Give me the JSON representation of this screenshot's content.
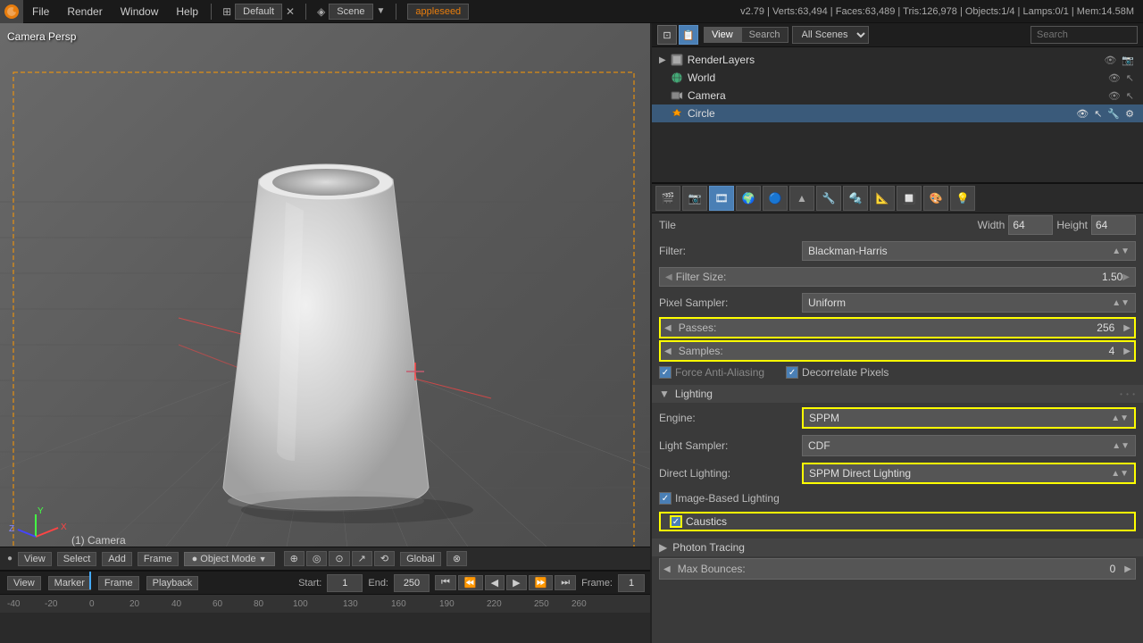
{
  "topbar": {
    "logo": "B",
    "menus": [
      "File",
      "Render",
      "Window",
      "Help"
    ],
    "workspace_icon": "⊞",
    "layout": "Default",
    "scene_icon": "◈",
    "scene": "Scene",
    "app_name": "appleseed",
    "version_info": "v2.79 | Verts:63,494 | Faces:63,489 | Tris:126,978 | Objects:1/4 | Lamps:0/1 | Mem:14.58M"
  },
  "viewport": {
    "label": "Camera Persp",
    "camera_label": "(1) Camera"
  },
  "timeline": {
    "marker_label": "Marker",
    "frame_label": "Frame",
    "playback_label": "Playback",
    "start_label": "Start:",
    "start_value": "1",
    "end_label": "End:",
    "end_value": "250",
    "current_frame": "1",
    "ruler_marks": [
      "-40",
      "-20",
      "0",
      "20",
      "40",
      "60",
      "80",
      "100",
      "130",
      "160",
      "190",
      "220",
      "250",
      "260"
    ],
    "buttons": {
      "view": "View",
      "select": "Select",
      "add": "Add",
      "frame": "Frame",
      "object_mode": "Object Mode",
      "global": "Global"
    }
  },
  "outliner": {
    "header_tabs": [
      "View",
      "Search"
    ],
    "scenes_label": "All Scenes",
    "items": [
      {
        "name": "RenderLayers",
        "icon": "📷",
        "indent": 0
      },
      {
        "name": "World",
        "icon": "🌍",
        "indent": 1
      },
      {
        "name": "Camera",
        "icon": "🎥",
        "indent": 1
      },
      {
        "name": "Circle",
        "icon": "▽",
        "indent": 1,
        "selected": true
      }
    ]
  },
  "properties": {
    "tabs": [
      "🎬",
      "📷",
      "🎞",
      "🌍",
      "🔵",
      "▲",
      "🔧",
      "🔩",
      "📐",
      "🔲",
      "🎨",
      "💡"
    ],
    "active_tab": 2,
    "tile": {
      "label": "Tile",
      "width_label": "Width",
      "width_value": "64",
      "height_label": "Height",
      "height_value": "64"
    },
    "filter": {
      "label": "Filter:",
      "value": "Blackman-Harris"
    },
    "filter_size": {
      "label": "Filter Size:",
      "value": "1.50"
    },
    "pixel_sampler": {
      "label": "Pixel Sampler:",
      "value": "Uniform"
    },
    "passes": {
      "label": "Passes:",
      "value": "256"
    },
    "samples": {
      "label": "Samples:",
      "value": "4"
    },
    "force_anti_aliasing": {
      "label": "Force Anti-Aliasing",
      "checked": true
    },
    "decorrelate_pixels": {
      "label": "Decorrelate Pixels",
      "checked": true
    },
    "lighting": {
      "section_label": "Lighting",
      "engine": {
        "label": "Engine:",
        "value": "SPPM"
      },
      "light_sampler": {
        "label": "Light Sampler:",
        "value": "CDF"
      },
      "direct_lighting": {
        "label": "Direct Lighting:",
        "value": "SPPM Direct Lighting"
      },
      "image_based_lighting": {
        "label": "Image-Based Lighting",
        "checked": true
      },
      "caustics": {
        "label": "Caustics",
        "checked": true
      }
    },
    "photon_tracing": {
      "label": "Photon Tracing"
    },
    "max_bounces": {
      "label": "Max Bounces:",
      "value": "0"
    }
  }
}
